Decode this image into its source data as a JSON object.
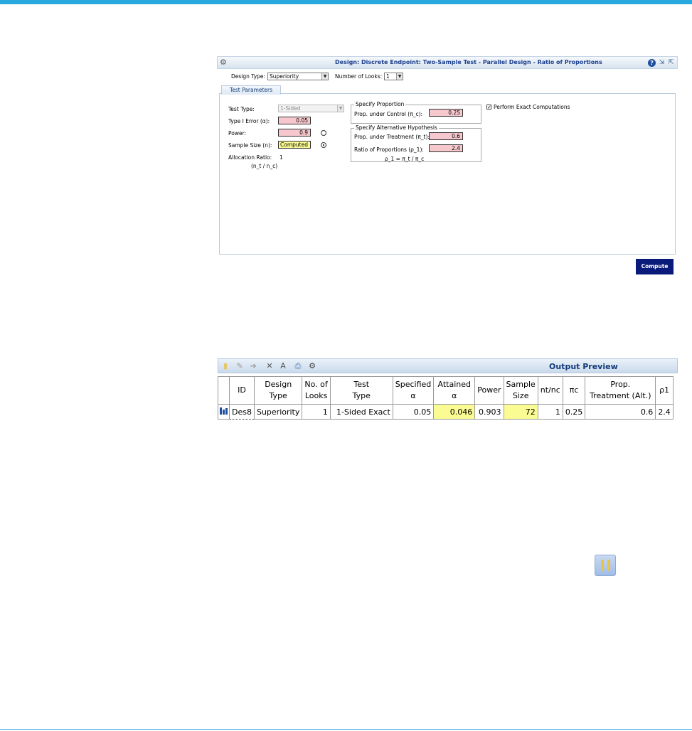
{
  "design": {
    "title": "Design: Discrete Endpoint: Two-Sample Test - Parallel Design - Ratio of Proportions",
    "design_type_label": "Design Type:",
    "design_type_value": "Superiority",
    "num_looks_label": "Number of Looks:",
    "num_looks_value": "1",
    "tab_label": "Test Parameters",
    "test_type_label": "Test Type:",
    "test_type_value": "1-Sided",
    "type1_error_label": "Type I Error (α):",
    "type1_error_value": "0.05",
    "power_label": "Power:",
    "power_value": "0.9",
    "sample_size_label": "Sample Size (n):",
    "sample_size_value": "Computed",
    "allocation_label": "Allocation Ratio:",
    "allocation_value": "1",
    "allocation_sub": "(n_t / n_c)",
    "specify_proportion_title": "Specify Proportion",
    "prop_control_label": "Prop. under Control (π_c):",
    "prop_control_value": "0.25",
    "alt_hypothesis_title": "Specify Alternative Hypothesis",
    "prop_treatment_label": "Prop. under Treatment (π_t):",
    "prop_treatment_value": "0.6",
    "ratio_label": "Ratio of Proportions (ρ_1):",
    "ratio_value": "2.4",
    "ratio_formula": "ρ_1 = π_t / π_c",
    "exact_label": "Perform Exact Computations",
    "exact_checked": true,
    "compute_label": "Compute"
  },
  "output": {
    "title": "Output Preview",
    "columns": [
      [
        "ID"
      ],
      [
        "Design",
        "Type"
      ],
      [
        "No. of",
        "Looks"
      ],
      [
        "Test",
        "Type"
      ],
      [
        "Specified",
        "α"
      ],
      [
        "Attained",
        "α"
      ],
      [
        "Power"
      ],
      [
        "Sample",
        "Size"
      ],
      [
        "nt/nc"
      ],
      [
        "πc"
      ],
      [
        "Prop.",
        "Treatment (Alt.)"
      ],
      [
        "ρ1"
      ]
    ],
    "row": {
      "id": "Des8",
      "design_type": "Superiority",
      "looks": "1",
      "test_type": "1-Sided Exact",
      "spec_alpha": "0.05",
      "att_alpha": "0.046",
      "power": "0.903",
      "sample_size": "72",
      "nt_nc": "1",
      "pi_c": "0.25",
      "prop_treatment": "0.6",
      "rho1": "2.4"
    }
  },
  "icons": {
    "accent": "#29a8e0",
    "highlight": "#fbfb93",
    "pink_field": "#f6c7cc",
    "compute_bg": "#0a1a7a"
  }
}
